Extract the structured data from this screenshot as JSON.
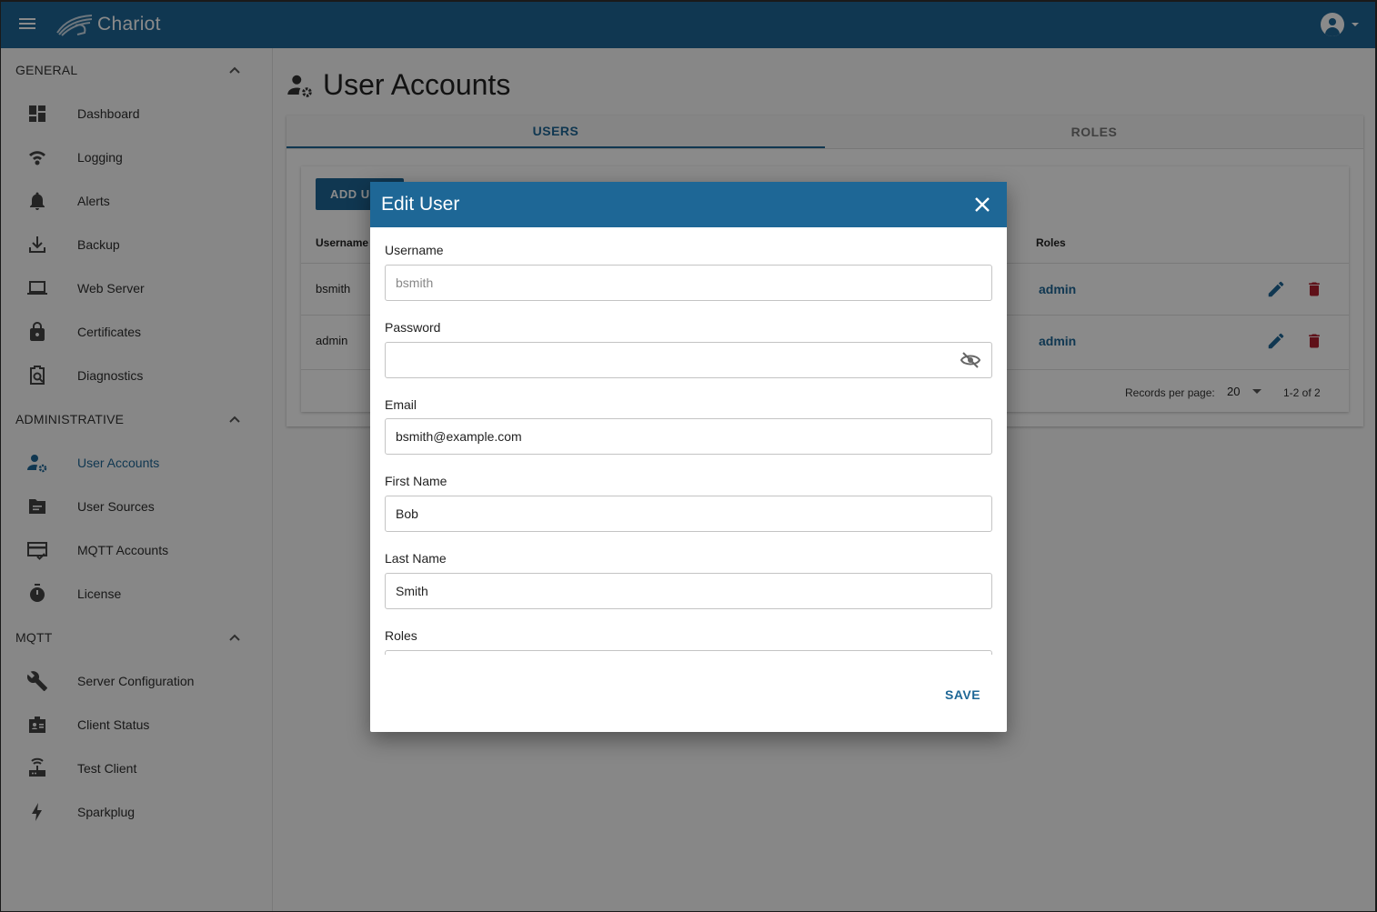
{
  "app": {
    "title": "Chariot"
  },
  "sidebar": {
    "sections": [
      {
        "label": "GENERAL",
        "items": [
          {
            "label": "Dashboard",
            "icon": "dashboard-icon"
          },
          {
            "label": "Logging",
            "icon": "logging-icon"
          },
          {
            "label": "Alerts",
            "icon": "bell-icon"
          },
          {
            "label": "Backup",
            "icon": "download-icon"
          },
          {
            "label": "Web Server",
            "icon": "laptop-icon"
          },
          {
            "label": "Certificates",
            "icon": "lock-icon"
          },
          {
            "label": "Diagnostics",
            "icon": "clipboard-search-icon"
          }
        ]
      },
      {
        "label": "ADMINISTRATIVE",
        "items": [
          {
            "label": "User Accounts",
            "icon": "user-cog-icon"
          },
          {
            "label": "User Sources",
            "icon": "folder-list-icon"
          },
          {
            "label": "MQTT Accounts",
            "icon": "card-check-icon"
          },
          {
            "label": "License",
            "icon": "timer-icon"
          }
        ]
      },
      {
        "label": "MQTT",
        "items": [
          {
            "label": "Server Configuration",
            "icon": "wrench-icon"
          },
          {
            "label": "Client Status",
            "icon": "badge-icon"
          },
          {
            "label": "Test Client",
            "icon": "router-icon"
          },
          {
            "label": "Sparkplug",
            "icon": "bolt-icon"
          }
        ]
      }
    ],
    "active_item": "User Accounts"
  },
  "main": {
    "title": "User Accounts",
    "tabs": [
      {
        "label": "USERS",
        "active": true
      },
      {
        "label": "ROLES",
        "active": false
      }
    ],
    "add_button": "ADD USER",
    "columns": {
      "username": "Username",
      "roles": "Roles"
    },
    "rows": [
      {
        "username": "bsmith",
        "role": "admin"
      },
      {
        "username": "admin",
        "role": "admin"
      }
    ],
    "pagination": {
      "label": "Records per page:",
      "per_page": "20",
      "range": "1-2 of 2"
    }
  },
  "dialog": {
    "title": "Edit User",
    "fields": {
      "username": {
        "label": "Username",
        "value": "bsmith"
      },
      "password": {
        "label": "Password",
        "value": ""
      },
      "email": {
        "label": "Email",
        "value": "bsmith@example.com"
      },
      "first_name": {
        "label": "First Name",
        "value": "Bob"
      },
      "last_name": {
        "label": "Last Name",
        "value": "Smith"
      },
      "roles": {
        "label": "Roles"
      }
    },
    "save_label": "SAVE"
  },
  "colors": {
    "primary": "#1e6796",
    "danger": "#b01e2e",
    "overlay": "rgba(0,0,0,0.46)"
  }
}
